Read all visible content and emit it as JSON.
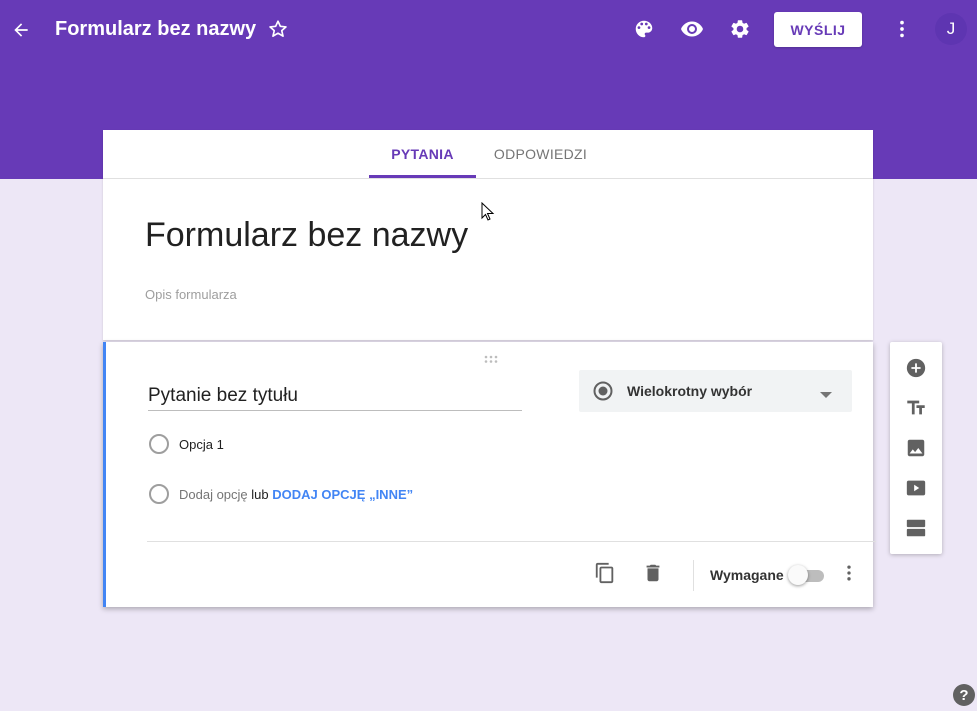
{
  "header": {
    "title": "Formularz bez nazwy",
    "send_label": "WYŚLIJ",
    "avatar_initial": "J",
    "icons": [
      "back-arrow-icon",
      "star-icon",
      "palette-icon",
      "eye-icon",
      "gear-icon",
      "more-vert-icon"
    ]
  },
  "tabs": [
    {
      "label": "PYTANIA",
      "active": true
    },
    {
      "label": "ODPOWIEDZI",
      "active": false
    }
  ],
  "form": {
    "title": "Formularz bez nazwy",
    "description_placeholder": "Opis formularza"
  },
  "question": {
    "title": "Pytanie bez tytułu",
    "type": "Wielokrotny wybór",
    "options": [
      "Opcja 1"
    ],
    "add_option": "Dodaj opcję",
    "or": "lub",
    "add_other": "DODAJ OPCJĘ „INNE”",
    "required_label": "Wymagane",
    "required": false
  },
  "side_toolbar": [
    "add-question-icon",
    "title-text-icon",
    "image-icon",
    "video-icon",
    "section-icon"
  ],
  "colors": {
    "primary": "#673ab7",
    "background": "#ede7f6",
    "accent_blue": "#4285f4"
  }
}
